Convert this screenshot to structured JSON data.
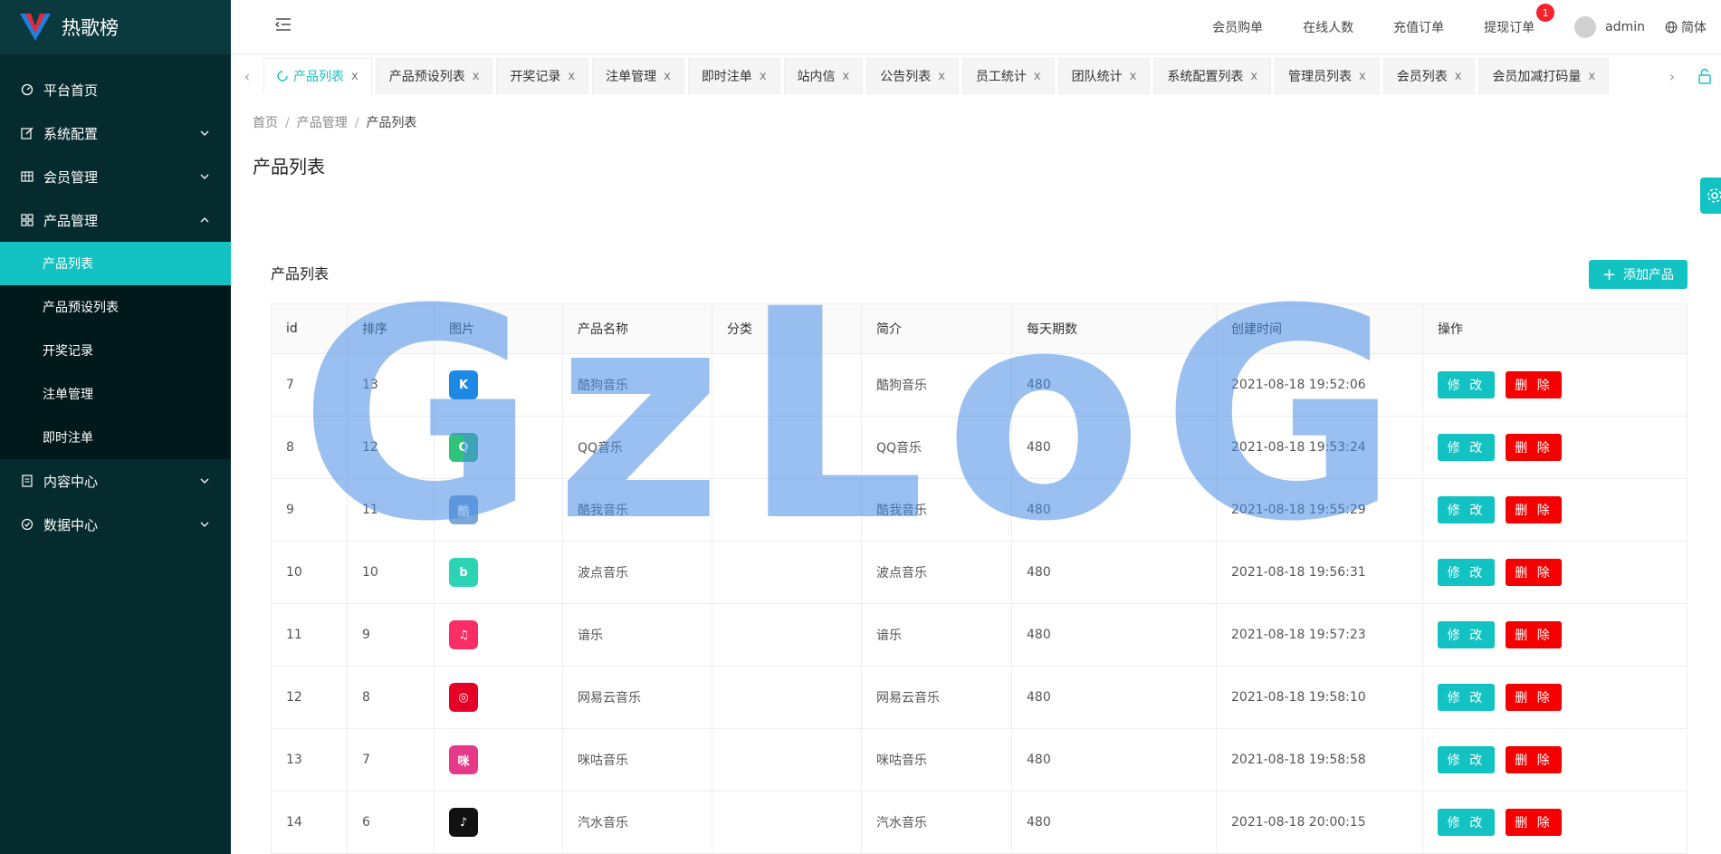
{
  "app": {
    "title": "热歌榜",
    "brand_color": "#13c2c2",
    "sidebar_color": "#062b2e"
  },
  "sidebar": {
    "items": [
      {
        "label": "平台首页",
        "icon": "dashboard-icon",
        "expandable": false
      },
      {
        "label": "系统配置",
        "icon": "edit-icon",
        "expandable": true
      },
      {
        "label": "会员管理",
        "icon": "table-icon",
        "expandable": true
      },
      {
        "label": "产品管理",
        "icon": "appstore-icon",
        "expandable": true,
        "expanded": true
      },
      {
        "label": "内容中心",
        "icon": "file-icon",
        "expandable": true
      },
      {
        "label": "数据中心",
        "icon": "check-circle-icon",
        "expandable": true
      }
    ],
    "sub_items": [
      "产品列表",
      "产品预设列表",
      "开奖记录",
      "注单管理",
      "即时注单"
    ],
    "active_sub": "产品列表"
  },
  "topbar": {
    "links": [
      "会员购单",
      "在线人数",
      "充值订单",
      "提现订单"
    ],
    "withdraw_badge": "1",
    "user": "admin",
    "lang": "简体"
  },
  "tabs": [
    "产品列表",
    "产品预设列表",
    "开奖记录",
    "注单管理",
    "即时注单",
    "站内信",
    "公告列表",
    "员工统计",
    "团队统计",
    "系统配置列表",
    "管理员列表",
    "会员列表",
    "会员加减打码量"
  ],
  "tab_close": "x",
  "breadcrumb": [
    "首页",
    "产品管理",
    "产品列表"
  ],
  "page_title": "产品列表",
  "card": {
    "title": "产品列表",
    "add_button": "添加产品"
  },
  "table": {
    "columns": [
      "id",
      "排序",
      "图片",
      "产品名称",
      "分类",
      "简介",
      "每天期数",
      "创建时间",
      "操作"
    ],
    "edit_label": "修 改",
    "delete_label": "删 除",
    "rows": [
      {
        "id": "7",
        "sort": "13",
        "icon": "kugou-icon",
        "icon_color": "#1e88e5",
        "glyph": "K",
        "name": "酷狗音乐",
        "category": "",
        "intro": "酷狗音乐",
        "daily": "480",
        "created": "2021-08-18 19:52:06"
      },
      {
        "id": "8",
        "sort": "12",
        "icon": "qq-music-icon",
        "icon_color": "#31c27c",
        "glyph": "Q",
        "name": "QQ音乐",
        "category": "",
        "intro": "QQ音乐",
        "daily": "480",
        "created": "2021-08-18 19:53:24"
      },
      {
        "id": "9",
        "sort": "11",
        "icon": "kuwo-icon",
        "icon_color": "#7aa7d8",
        "glyph": "酷",
        "name": "酷我音乐",
        "category": "",
        "intro": "酷我音乐",
        "daily": "480",
        "created": "2021-08-18 19:55:29"
      },
      {
        "id": "10",
        "sort": "10",
        "icon": "bodian-icon",
        "icon_color": "#2bd4b4",
        "glyph": "b",
        "name": "波点音乐",
        "category": "",
        "intro": "波点音乐",
        "daily": "480",
        "created": "2021-08-18 19:56:31"
      },
      {
        "id": "11",
        "sort": "9",
        "icon": "music-note-icon",
        "icon_color": "#fa2d64",
        "glyph": "♫",
        "name": "谙乐",
        "category": "",
        "intro": "谙乐",
        "daily": "480",
        "created": "2021-08-18 19:57:23"
      },
      {
        "id": "12",
        "sort": "8",
        "icon": "netease-icon",
        "icon_color": "#e60026",
        "glyph": "◎",
        "name": "网易云音乐",
        "category": "",
        "intro": "网易云音乐",
        "daily": "480",
        "created": "2021-08-18 19:58:10"
      },
      {
        "id": "13",
        "sort": "7",
        "icon": "migu-icon",
        "icon_color": "#e8388a",
        "glyph": "咪",
        "name": "咪咕音乐",
        "category": "",
        "intro": "咪咕音乐",
        "daily": "480",
        "created": "2021-08-18 19:58:58"
      },
      {
        "id": "14",
        "sort": "6",
        "icon": "qishui-icon",
        "icon_color": "#111111",
        "glyph": "♪",
        "name": "汽水音乐",
        "category": "",
        "intro": "汽水音乐",
        "daily": "480",
        "created": "2021-08-18 20:00:15"
      }
    ]
  },
  "watermark": "GzLoG"
}
